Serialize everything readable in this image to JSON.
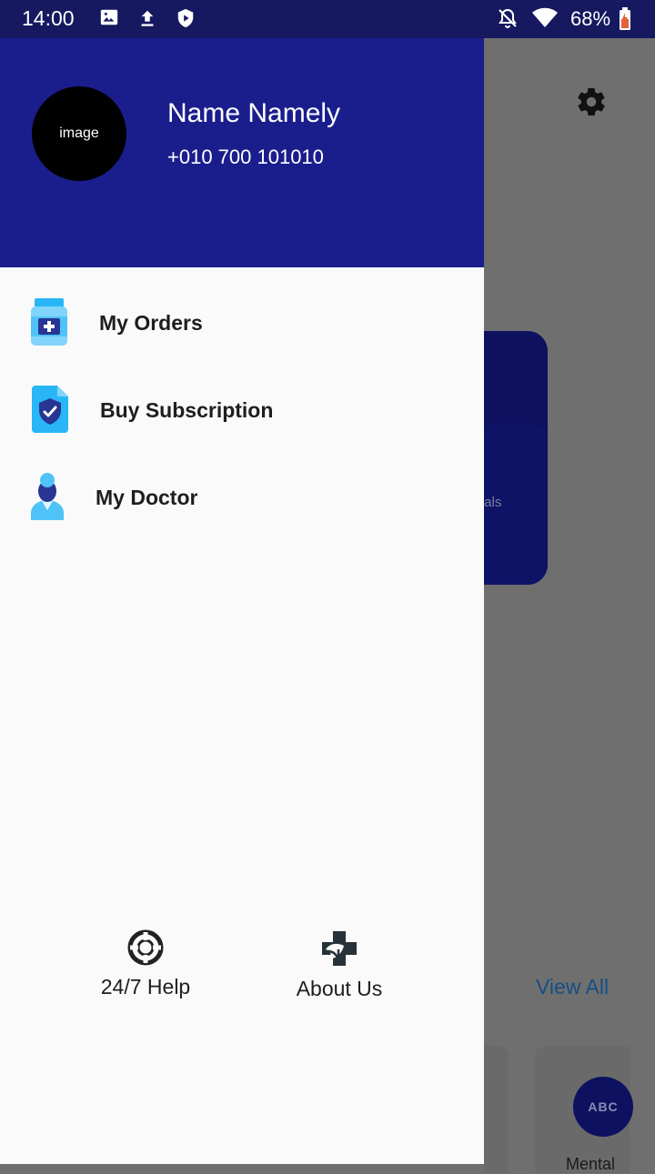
{
  "status_bar": {
    "time": "14:00",
    "battery_percent": "68%",
    "icons": [
      "image-icon",
      "upload-icon",
      "shield-play-icon",
      "bell-off-icon",
      "wifi-icon",
      "battery-charging-icon"
    ]
  },
  "drawer": {
    "header": {
      "avatar_text": "image",
      "name": "Name Namely",
      "phone": "+010 700 101010"
    },
    "menu": [
      {
        "label": "My Orders",
        "icon": "medicine-bottle-icon"
      },
      {
        "label": "Buy Subscription",
        "icon": "shield-document-icon"
      },
      {
        "label": "My Doctor",
        "icon": "doctor-icon"
      }
    ],
    "footer": {
      "help": {
        "label": "24/7 Help",
        "icon": "lifebuoy-icon"
      },
      "about": {
        "label": "About Us",
        "icon": "medical-cross-leaf-icon"
      }
    }
  },
  "background": {
    "settings_icon": "gear-icon",
    "card_label": "tals",
    "view_all": "View All",
    "avatar_text": "ABC",
    "tile_text": "Mental"
  },
  "colors": {
    "status_bar": "#16195f",
    "drawer_header": "#1a1e8c",
    "drawer_bg": "#fafafa",
    "scrim": "#6f6f6f",
    "link": "#164f85"
  }
}
